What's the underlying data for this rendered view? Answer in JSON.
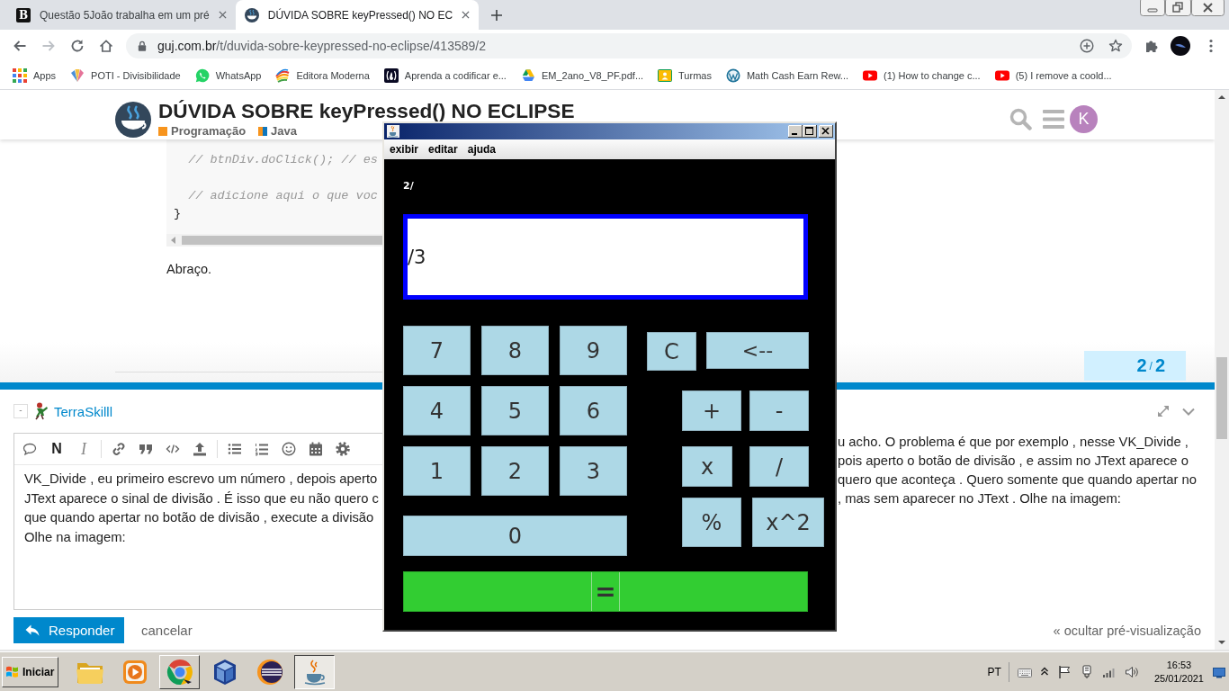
{
  "browser": {
    "tabs": [
      {
        "kind": "letter",
        "icon_letter": "B",
        "title": "Questão 5João trabalha em um pré",
        "selected": false
      },
      {
        "kind": "site",
        "title": "DÚVIDA SOBRE keyPressed() NO EC",
        "selected": true
      }
    ],
    "url": {
      "host": "guj.com.br",
      "path": "/t/duvida-sobre-keypressed-no-eclipse/413589/2"
    },
    "bookmarks": [
      {
        "kind": "grid",
        "label": "Apps"
      },
      {
        "kind": "fan",
        "label": "POTI - Divisibilidade"
      },
      {
        "kind": "chat",
        "label": "WhatsApp"
      },
      {
        "kind": "swirl",
        "label": "Editora Moderna"
      },
      {
        "kind": "code",
        "label": "Aprenda a codificar e..."
      },
      {
        "kind": "drive",
        "label": "EM_2ano_V8_PF.pdf..."
      },
      {
        "kind": "board",
        "label": "Turmas"
      },
      {
        "kind": "wp",
        "label": "Math Cash Earn Rew..."
      },
      {
        "kind": "video",
        "label": "(1) How to change c..."
      },
      {
        "kind": "video",
        "label": "(5) I remove a coold..."
      }
    ]
  },
  "header": {
    "avatar_letter": "K"
  },
  "topic": {
    "title": "DÚVIDA SOBRE keyPressed() NO ECLIPSE",
    "categories": [
      {
        "name": "Programação",
        "color": "#f7941d"
      },
      {
        "name": "Java",
        "color": "#0e76bd",
        "parent": {
          "color": "#f7941d"
        }
      }
    ]
  },
  "code_lines": [
    {
      "kind": "comment",
      "text": "  // btnDiv.doClick(); // es"
    },
    {
      "kind": "blank"
    },
    {
      "kind": "comment",
      "text": "  // adicione aqui o que voc"
    },
    {
      "kind": "code",
      "text": "}"
    }
  ],
  "post_text": "Abraço.",
  "post_counter": {
    "current": "2",
    "separator": "/",
    "total": "2"
  },
  "composer": {
    "collapse_label": "-",
    "username": "TerraSkilll",
    "toolbar": {
      "bold_label": "N",
      "italic_label": "I"
    },
    "editor_lines": [
      "VK_Divide , eu primeiro escrevo um número , depois aperto",
      "JText aparece o sinal de divisão . É isso que eu não quero c",
      "que quando apertar no botão de divisão , execute a divisão",
      "Olhe na imagem:"
    ],
    "preview_lines": [
      "u acho. O problema é que por exemplo , nesse VK_Divide ,",
      "pois aperto o botão de divisão , e assim no JText aparece o",
      "quero que aconteça . Quero somente que quando apertar no",
      ", mas sem aparecer no JText . Olhe na imagem:"
    ],
    "submit_label": "Responder",
    "cancel_label": "cancelar",
    "hide_preview_label": "« ocultar pré-visualização"
  },
  "calculator": {
    "menu": [
      "exibir",
      "editar",
      "ajuda"
    ],
    "history": "2/",
    "display": "/3",
    "digit_rows": [
      [
        "7",
        "8",
        "9"
      ],
      [
        "4",
        "5",
        "6"
      ],
      [
        "1",
        "2",
        "3"
      ],
      [
        "0"
      ]
    ],
    "function_rows": [
      [
        "C",
        "<--"
      ],
      [
        "+",
        "-"
      ],
      [
        "x",
        "/"
      ],
      [
        "%",
        "x^2"
      ]
    ],
    "equals": "="
  },
  "taskbar": {
    "start_label": "Iniciar",
    "apps": [
      {
        "kind": "folder",
        "open": false,
        "selected": false
      },
      {
        "kind": "player",
        "open": false,
        "selected": false
      },
      {
        "kind": "browser",
        "open": true,
        "selected": false
      },
      {
        "kind": "cube",
        "open": false,
        "selected": false
      },
      {
        "kind": "orb",
        "open": false,
        "selected": false
      },
      {
        "kind": "cup",
        "open": true,
        "selected": true
      }
    ],
    "language": "PT",
    "time": "16:53",
    "date": "25/01/2021"
  }
}
